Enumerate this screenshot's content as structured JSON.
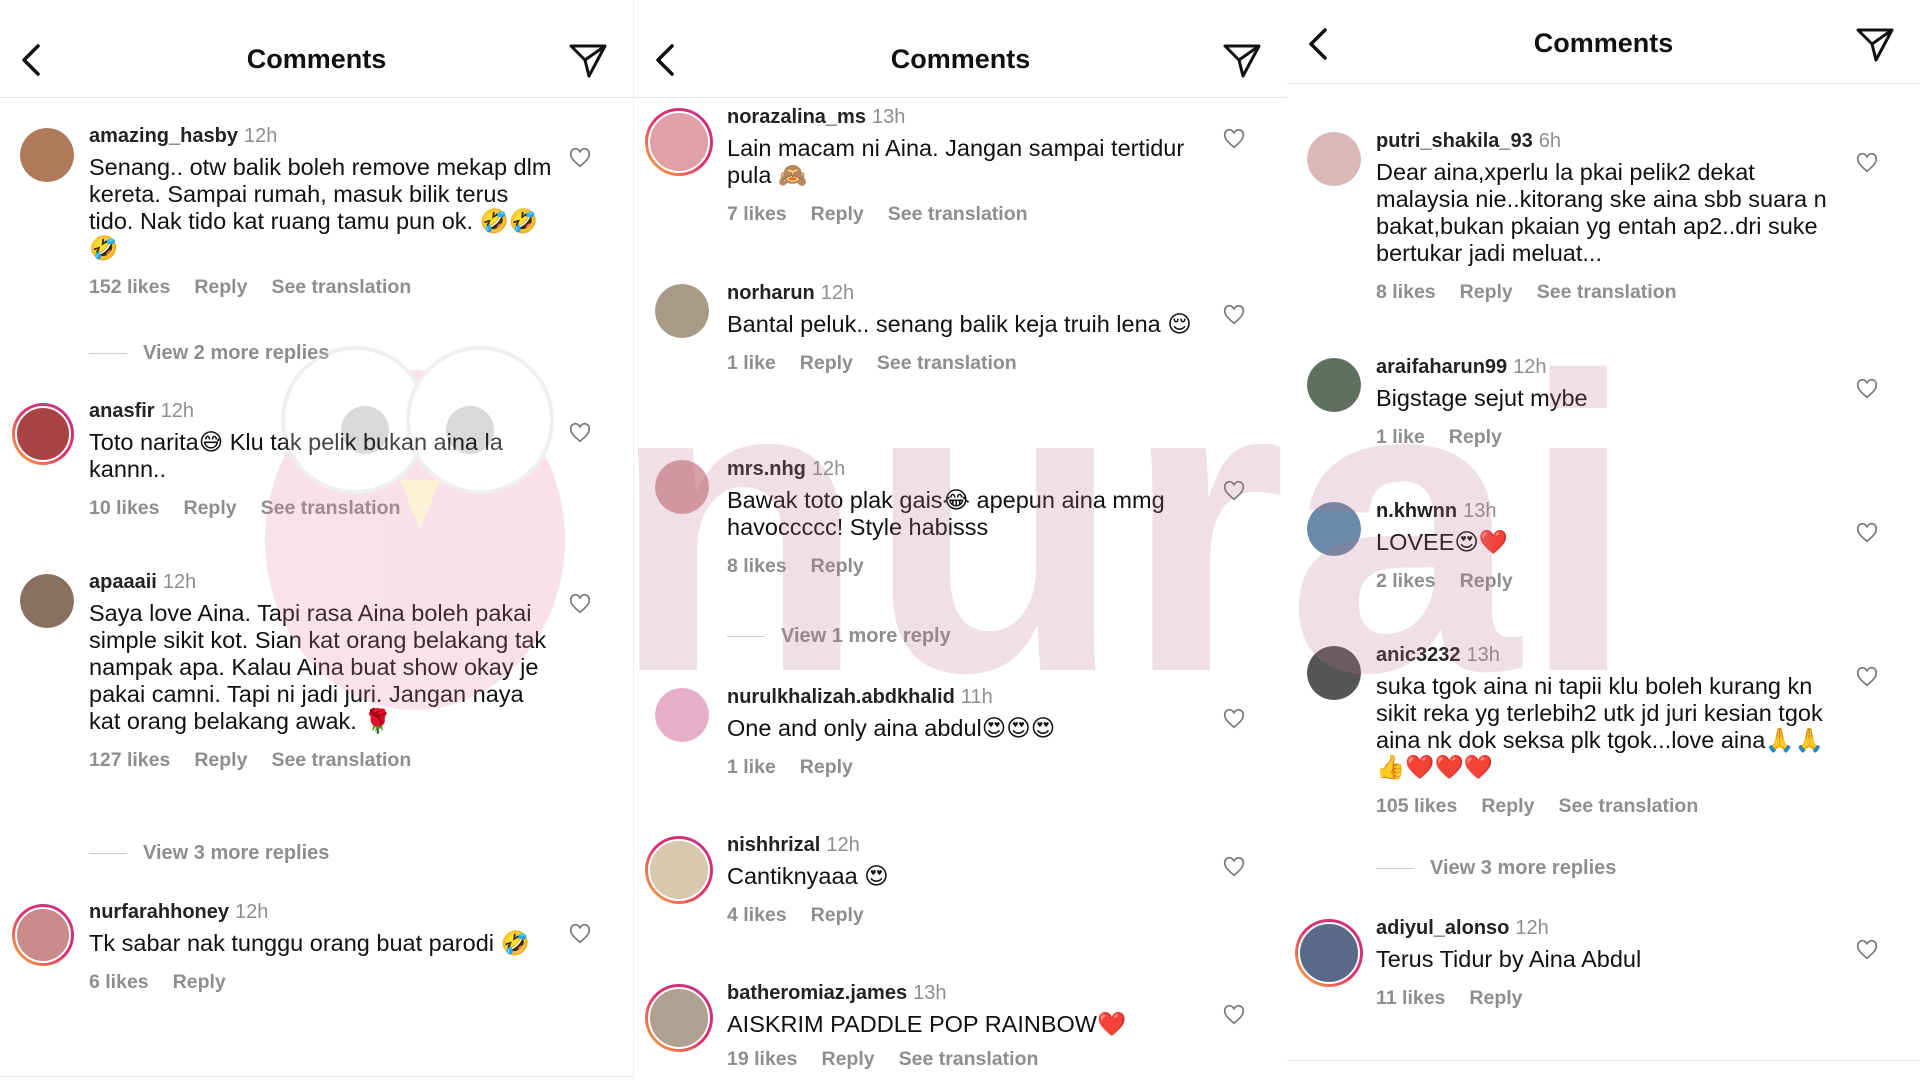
{
  "panels": [
    {
      "header": {
        "title": "Comments"
      },
      "comments": [
        {
          "username": "amazing_hasby",
          "time": "12h",
          "text": "Senang.. otw balik boleh remove mekap dlm kereta. Sampai rumah, masuk bilik terus tido. Nak tido kat ruang tamu pun ok. 🤣🤣🤣",
          "likes": "152 likes",
          "reply": "Reply",
          "translation": "See translation",
          "more_replies": "View 2 more replies",
          "avatar_color": "#b07a5a"
        },
        {
          "username": "anasfir",
          "time": "12h",
          "text": "Toto narita😅 Klu tak pelik bukan aina la kannn..",
          "likes": "10 likes",
          "reply": "Reply",
          "translation": "See translation",
          "more_replies": "",
          "avatar_color": "#a44"
        },
        {
          "username": "apaaaii",
          "time": "12h",
          "text": "Saya love Aina. Tapi rasa Aina boleh pakai simple sikit kot. Sian kat orang belakang tak nampak apa. Kalau Aina buat show okay je pakai camni. Tapi ni jadi juri. Jangan naya kat orang belakang awak. 🌹",
          "likes": "127 likes",
          "reply": "Reply",
          "translation": "See translation",
          "more_replies": "View 3 more replies",
          "avatar_color": "#8a7060"
        },
        {
          "username": "nurfarahhoney",
          "time": "12h",
          "text": "Tk sabar nak tunggu orang buat parodi 🤣",
          "likes": "6 likes",
          "reply": "Reply",
          "translation": "",
          "more_replies": "",
          "avatar_color": "#c98a8a"
        }
      ]
    },
    {
      "header": {
        "title": "Comments"
      },
      "comments": [
        {
          "username": "norazalina_ms",
          "time": "13h",
          "text": "Lain macam ni Aina. Jangan sampai tertidur pula 🙈",
          "likes": "7 likes",
          "reply": "Reply",
          "translation": "See translation",
          "more_replies": "",
          "avatar_color": "#e0a0a8"
        },
        {
          "username": "norharun",
          "time": "12h",
          "text": "Bantal peluk.. senang balik keja truih lena 😌",
          "likes": "1 like",
          "reply": "Reply",
          "translation": "See translation",
          "more_replies": "",
          "avatar_color": "#a89a86"
        },
        {
          "username": "mrs.nhg",
          "time": "12h",
          "text": "Bawak toto plak gais😂 apepun aina mmg havoccccc! Style habisss",
          "likes": "8 likes",
          "reply": "Reply",
          "translation": "",
          "more_replies": "View 1 more reply",
          "avatar_color": "#d8a0a8"
        },
        {
          "username": "nurulkhalizah.abdkhalid",
          "time": "11h",
          "text": "One and only aina abdul😍😍😍",
          "likes": "1 like",
          "reply": "Reply",
          "translation": "",
          "more_replies": "",
          "avatar_color": "#e8b0c8"
        },
        {
          "username": "nishhrizal",
          "time": "12h",
          "text": "Cantiknyaaa 😍",
          "likes": "4 likes",
          "reply": "Reply",
          "translation": "",
          "more_replies": "",
          "avatar_color": "#d8c8b0"
        },
        {
          "username": "batheromiaz.james",
          "time": "13h",
          "text": "AISKRIM PADDLE POP RAINBOW❤️",
          "likes": "19 likes",
          "reply": "Reply",
          "translation": "See translation",
          "more_replies": "",
          "avatar_color": "#b0a090"
        }
      ]
    },
    {
      "header": {
        "title": "Comments"
      },
      "comments": [
        {
          "username": "putri_shakila_93",
          "time": "6h",
          "text": "Dear aina,xperlu la pkai pelik2 dekat malaysia nie..kitorang ske aina sbb suara n bakat,bukan pkaian yg entah ap2..dri suke bertukar jadi meluat...",
          "likes": "8 likes",
          "reply": "Reply",
          "translation": "See translation",
          "more_replies": "",
          "avatar_color": "#d8b8b8"
        },
        {
          "username": "araifaharun99",
          "time": "12h",
          "text": "Bigstage sejut mybe",
          "likes": "1 like",
          "reply": "Reply",
          "translation": "",
          "more_replies": "",
          "avatar_color": "#607060"
        },
        {
          "username": "n.khwnn",
          "time": "13h",
          "text": "LOVEE😍❤️",
          "likes": "2 likes",
          "reply": "Reply",
          "translation": "",
          "more_replies": "",
          "avatar_color": "#6a8aa8"
        },
        {
          "username": "anic3232",
          "time": "13h",
          "text": "suka tgok aina ni tapii klu boleh kurang kn sikit reka yg terlebih2 utk jd juri kesian tgok aina nk dok seksa plk tgok...love aina🙏🙏👍❤️❤️❤️",
          "likes": "105 likes",
          "reply": "Reply",
          "translation": "See translation",
          "more_replies": "View 3 more replies",
          "avatar_color": "#555"
        },
        {
          "username": "adiyul_alonso",
          "time": "12h",
          "text": "Terus Tidur by Aina Abdul",
          "likes": "11 likes",
          "reply": "Reply",
          "translation": "",
          "more_replies": "",
          "avatar_color": "#5a6a8a"
        }
      ]
    }
  ],
  "watermark": {
    "text": "nurai"
  }
}
